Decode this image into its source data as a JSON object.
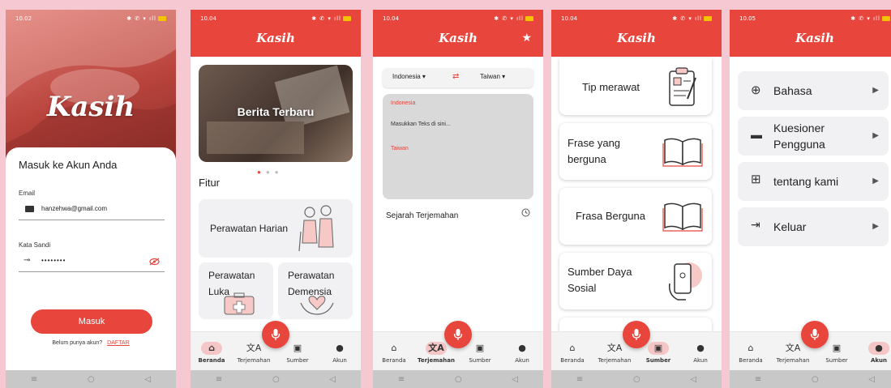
{
  "status_times": [
    "10.02",
    "10.04",
    "10.04",
    "10.04",
    "10.05"
  ],
  "app_title": "Kasih",
  "login": {
    "brand": "Kasih",
    "heading": "Masuk ke Akun Anda",
    "email_label": "Email",
    "email_value": "hanzehwa@gmail.com",
    "password_label": "Kata Sandi",
    "password_value": "••••••••",
    "submit": "Masuk",
    "no_account": "Belum punya akun?",
    "register": "DAFTAR"
  },
  "nav": {
    "home": "Beranda",
    "translate": "Terjemahan",
    "sources": "Sumber",
    "account": "Akun"
  },
  "home": {
    "banner": "Berita Terbaru",
    "section": "Fitur",
    "features": [
      "Perawatan Harian",
      "Perawatan Luka",
      "Perawatan Demensia"
    ]
  },
  "translate": {
    "source_lang": "Indonesia",
    "target_lang": "Taiwan",
    "source_label": "Indonesia",
    "placeholder": "Masukkan Teks di sini...",
    "target_label": "Taiwan",
    "history": "Sejarah Terjemahan"
  },
  "sources": {
    "items": [
      "Tip merawat",
      "Frase yang berguna",
      "Frasa Berguna",
      "Sumber Daya Sosial"
    ]
  },
  "account": {
    "items": [
      "Bahasa",
      "Kuesioner Pengguna",
      "tentang kami",
      "Keluar"
    ]
  },
  "colors": {
    "primary": "#e8453c",
    "background": "#f6c9d2",
    "active_nav": "#f5c6c6"
  }
}
